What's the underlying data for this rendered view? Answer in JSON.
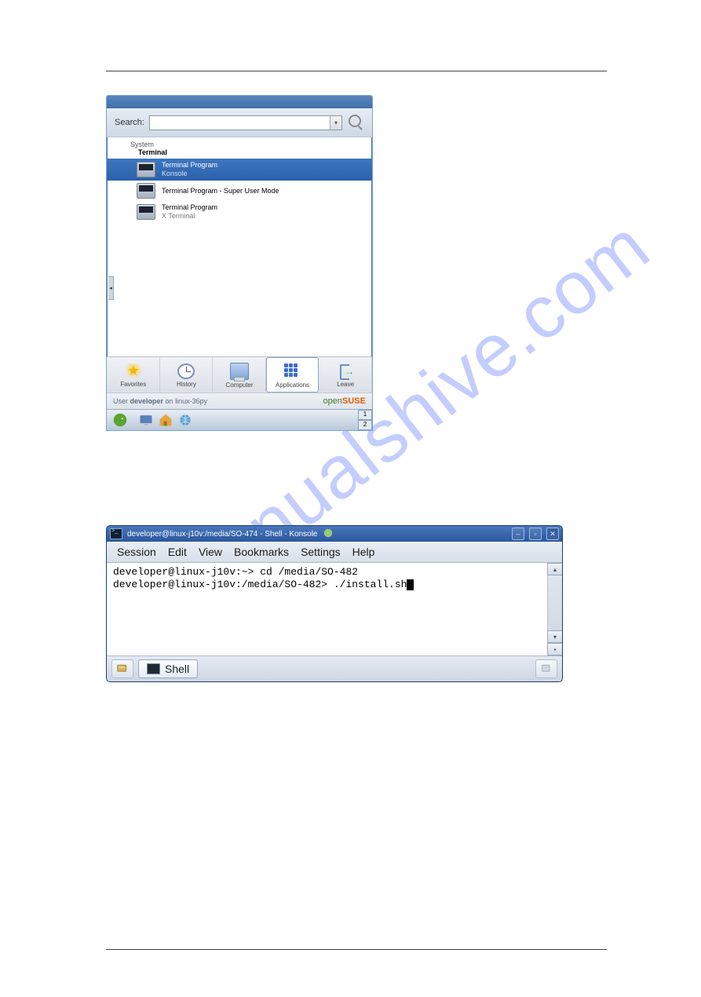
{
  "watermark": "manualshive.com",
  "menu": {
    "search_label": "Search:",
    "search_value": "",
    "breadcrumb_top": "System",
    "breadcrumb_leaf": "Terminal",
    "items": [
      {
        "title": "Terminal Program",
        "sub": "Konsole",
        "selected": true
      },
      {
        "title": "Terminal Program - Super User Mode",
        "sub": ""
      },
      {
        "title": "Terminal Program",
        "sub": "X Terminal"
      }
    ],
    "tabs": {
      "favorites": "Favorites",
      "history": "History",
      "computer": "Computer",
      "applications": "Applications",
      "leave": "Leave"
    },
    "footer": {
      "prefix": "User ",
      "user": "developer",
      "mid": " on ",
      "host": "linux-36py"
    },
    "suse_open": "open",
    "suse_brand": "SUSE",
    "desks": [
      "1",
      "2"
    ]
  },
  "konsole": {
    "title": "developer@linux-j10v:/media/SO-474 - Shell - Konsole",
    "menubar": [
      "Session",
      "Edit",
      "View",
      "Bookmarks",
      "Settings",
      "Help"
    ],
    "line1": "developer@linux-j10v:~> cd /media/SO-482",
    "line2": "developer@linux-j10v:/media/SO-482> ./install.sh",
    "shell_tab": "Shell"
  }
}
